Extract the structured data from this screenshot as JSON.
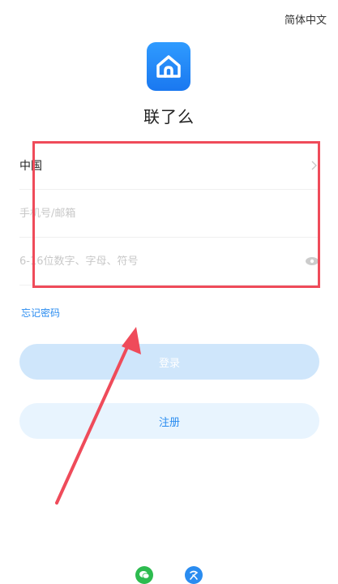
{
  "header": {
    "language_label": "简体中文"
  },
  "app": {
    "name": "联了么",
    "logo_icon": "home-icon",
    "brand_color": "#1a78f0"
  },
  "form": {
    "country": {
      "label": "中国",
      "icon": "chevron-right-icon"
    },
    "account": {
      "placeholder": "手机号/邮箱"
    },
    "password": {
      "placeholder": "6-16位数字、字母、符号",
      "icon": "eye-icon"
    }
  },
  "links": {
    "forgot_password": "忘记密码"
  },
  "buttons": {
    "login_label": "登录",
    "register_label": "注册"
  },
  "social": {
    "wechat_icon": "wechat-icon",
    "other_icon": "cloud-login-icon"
  },
  "annotations": {
    "highlight_color": "#ef4b5a"
  }
}
